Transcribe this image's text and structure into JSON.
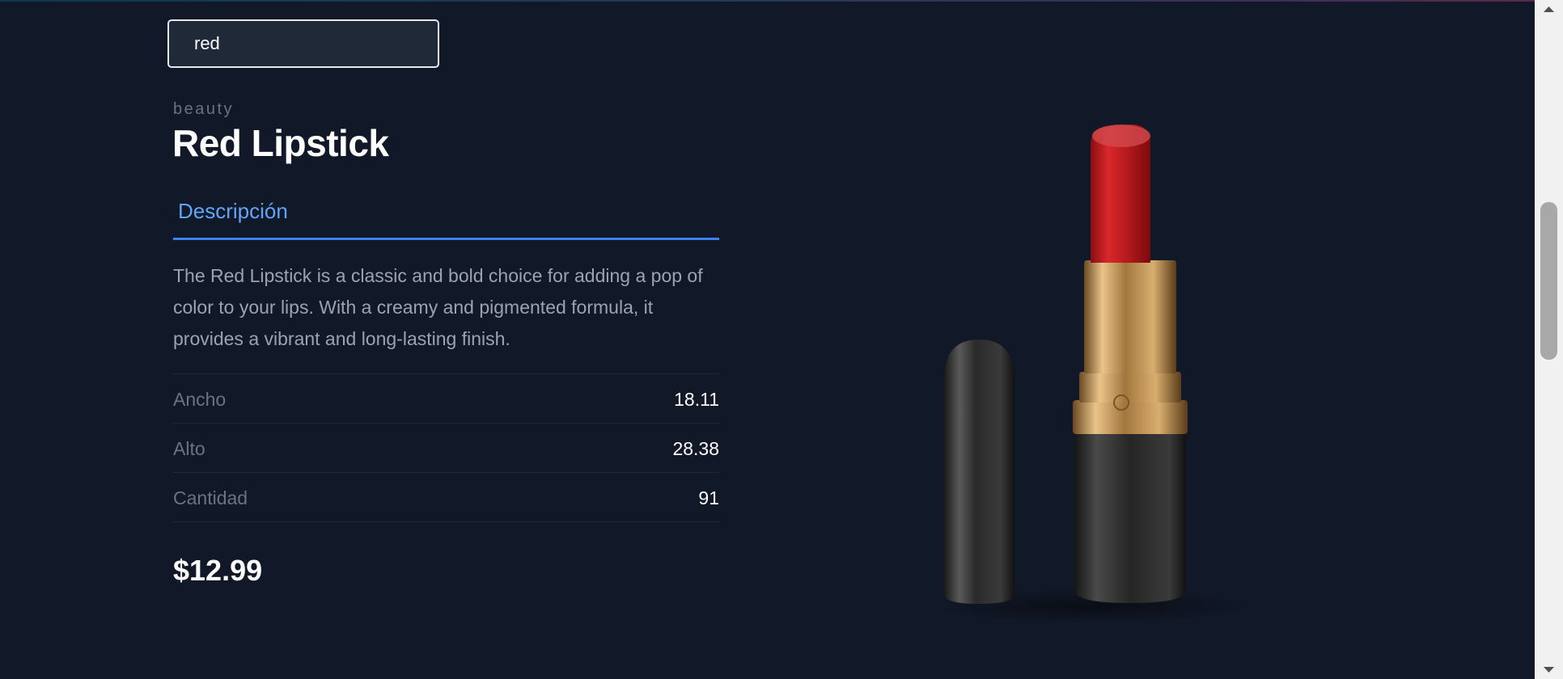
{
  "search": {
    "value": "red"
  },
  "product": {
    "category": "beauty",
    "title": "Red Lipstick",
    "tab_label": "Descripción",
    "description": "The Red Lipstick is a classic and bold choice for adding a pop of color to your lips. With a creamy and pigmented formula, it provides a vibrant and long-lasting finish.",
    "specs": [
      {
        "label": "Ancho",
        "value": "18.11"
      },
      {
        "label": "Alto",
        "value": "28.38"
      },
      {
        "label": "Cantidad",
        "value": "91"
      }
    ],
    "price": "$12.99"
  },
  "colors": {
    "background": "#111827",
    "accent": "#3b82f6",
    "tab_text": "#60a5fa",
    "muted_text": "#6b7280",
    "description_text": "#9ca3af",
    "lipstick_red": "#c8191c"
  },
  "icons": {
    "scroll_up": "triangle-up-icon",
    "scroll_down": "triangle-down-icon"
  }
}
